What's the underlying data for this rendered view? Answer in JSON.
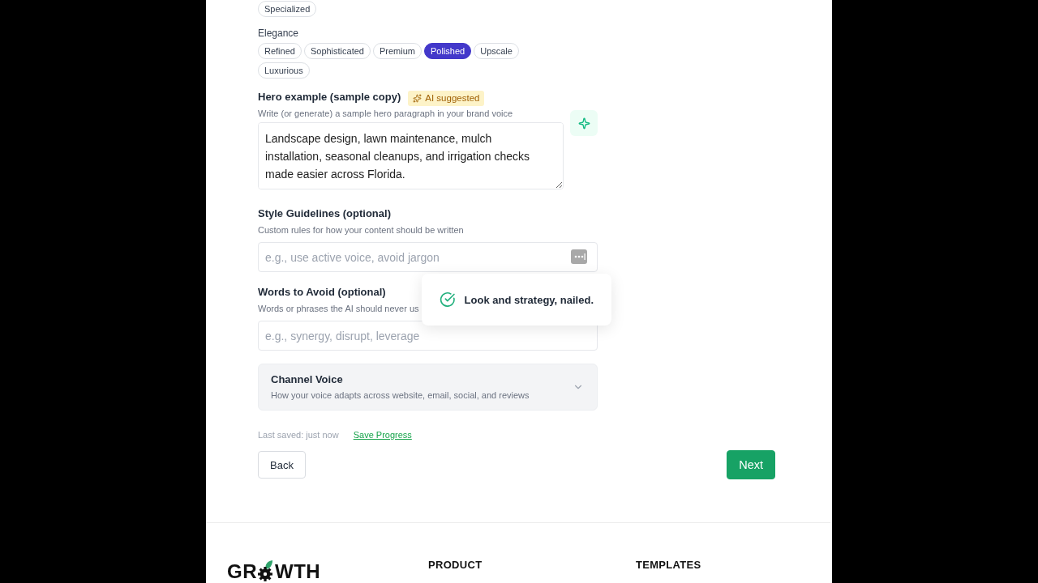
{
  "tone_groups": [
    {
      "chips": [
        {
          "label": "Specialized",
          "selected": false
        }
      ]
    },
    {
      "label": "Elegance",
      "chips": [
        {
          "label": "Refined",
          "selected": false
        },
        {
          "label": "Sophisticated",
          "selected": false
        },
        {
          "label": "Premium",
          "selected": false
        },
        {
          "label": "Polished",
          "selected": true
        },
        {
          "label": "Upscale",
          "selected": false
        },
        {
          "label": "Luxurious",
          "selected": false
        }
      ]
    }
  ],
  "hero_example": {
    "label": "Hero example (sample copy)",
    "badge": "AI suggested",
    "description": "Write (or generate) a sample hero paragraph in your brand voice",
    "value": "Landscape design, lawn maintenance, mulch installation, seasonal cleanups, and irrigation checks made easier across Florida."
  },
  "fields": [
    {
      "kind": "extension",
      "label": "Style Guidelines (optional)",
      "description": "Custom rules for how your content should be written",
      "placeholder": "e.g., use active voice, avoid jargon"
    },
    {
      "kind": "plain",
      "label": "Words to Avoid (optional)",
      "description": "Words or phrases the AI should never us",
      "placeholder": "e.g., synergy, disrupt, leverage"
    }
  ],
  "channel_voice": {
    "title": "Channel Voice",
    "description": "How your voice adapts across website, email, social, and reviews",
    "expanded": false
  },
  "save_status": {
    "text": "Last saved: just now",
    "link": "Save Progress"
  },
  "buttons": [
    {
      "kind": "secondary",
      "label": "Back"
    },
    {
      "kind": "primary",
      "label": "Next"
    }
  ],
  "toast": {
    "message": "Look and strategy, nailed."
  },
  "footer": {
    "logo": {
      "start": "GR",
      "end": "WTH"
    },
    "columns": [
      "PRODUCT",
      "TEMPLATES"
    ]
  }
}
